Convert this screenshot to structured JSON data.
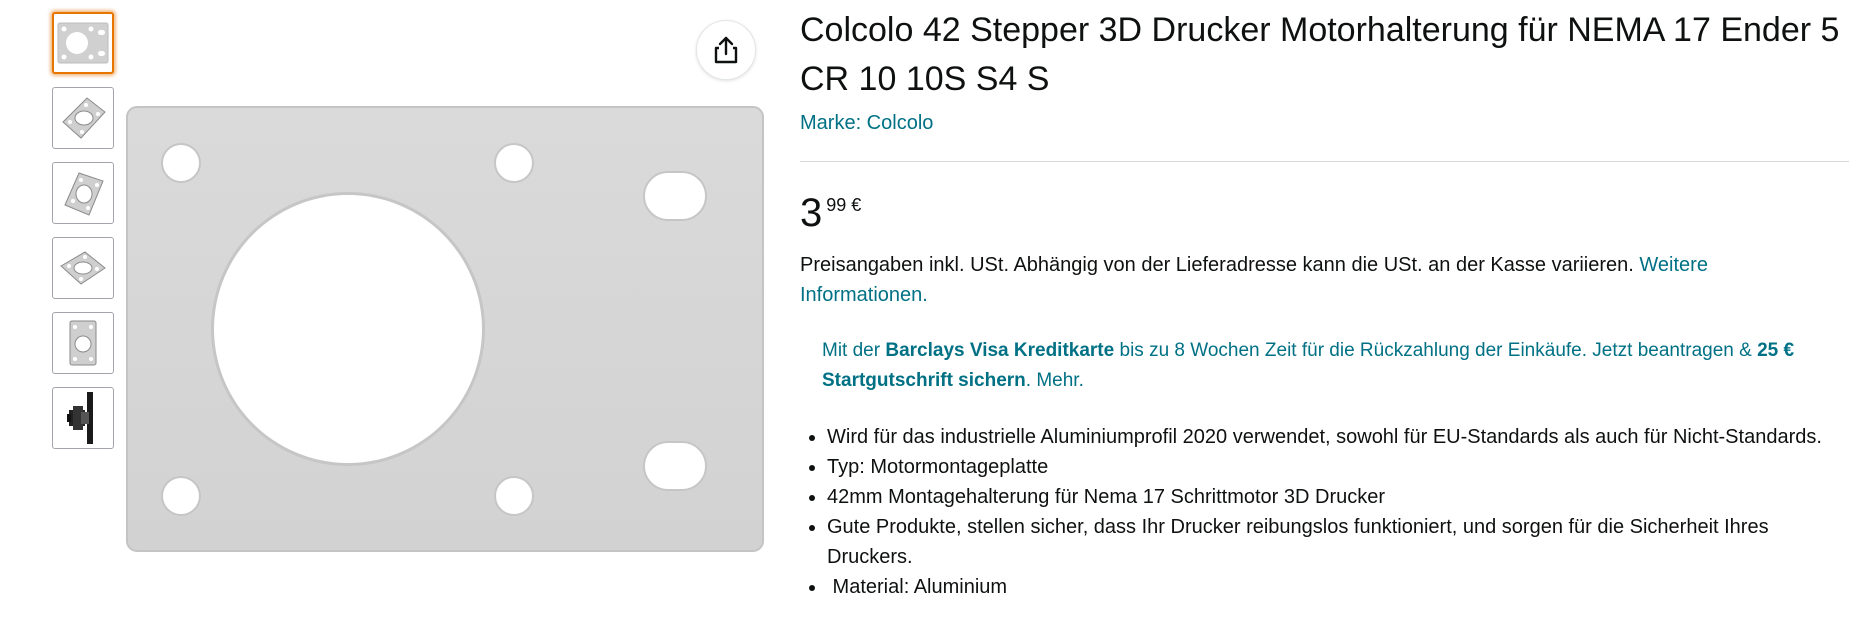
{
  "gallery": {
    "thumbnails": [
      {
        "icon": "mount-plate-front-thumbnail",
        "selected": true
      },
      {
        "icon": "mount-plate-angled-thumbnail",
        "selected": false
      },
      {
        "icon": "mount-plate-angled-thumbnail",
        "selected": false
      },
      {
        "icon": "mount-plate-tilted-thumbnail",
        "selected": false
      },
      {
        "icon": "mount-plate-vertical-thumbnail",
        "selected": false
      },
      {
        "icon": "mounted-on-profile-thumbnail",
        "selected": false
      }
    ],
    "share_icon": "share-icon"
  },
  "product": {
    "title": "Colcolo 42 Stepper 3D Drucker Motorhalterung für NEMA 17 Ender 5 CR 10 10S S4 S",
    "brand": "Marke: Colcolo",
    "price": {
      "whole": "3",
      "fraction": "99 €"
    },
    "tax_note": "Preisangaben inkl. USt. Abhängig von der Lieferadresse kann die USt. an der Kasse variieren.",
    "tax_link": "Weitere Informationen.",
    "promo": {
      "prefix": "Mit der ",
      "card": "Barclays Visa Kreditkarte",
      "middle": " bis zu 8 Wochen Zeit für die Rückzahlung der Einkäufe. Jetzt beantragen & ",
      "bonus": "25 € Startgutschrift sichern",
      "suffix": ". Mehr."
    },
    "bullets": [
      "Wird für das industrielle Aluminiumprofil 2020 verwendet, sowohl für EU-Standards als auch für Nicht-Standards.",
      "Typ: Motormontageplatte",
      "42mm Montagehalterung für Nema 17 Schrittmotor 3D Drucker",
      "Gute Produkte, stellen sicher, dass Ihr Drucker reibungslos funktioniert, und sorgen für die Sicherheit Ihres Druckers.",
      " Material: Aluminium"
    ]
  },
  "colors": {
    "link": "#007185",
    "text": "#0f1111",
    "selected_border": "#e77600",
    "plate": "#d7d7d7"
  }
}
